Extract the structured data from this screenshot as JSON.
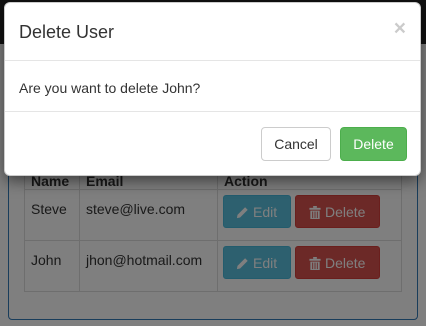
{
  "table": {
    "headers": {
      "name": "Name",
      "email": "Email",
      "action": "Action"
    },
    "rows": [
      {
        "name": "Steve",
        "email": "steve@live.com",
        "edit_label": "Edit",
        "delete_label": "Delete"
      },
      {
        "name": "John",
        "email": "jhon@hotmail.com",
        "edit_label": "Edit",
        "delete_label": "Delete"
      }
    ]
  },
  "modal": {
    "title": "Delete User",
    "close_label": "×",
    "message": "Are you want to delete John?",
    "cancel_label": "Cancel",
    "confirm_label": "Delete"
  },
  "icons": {
    "edit": "pencil-icon",
    "delete": "trash-icon",
    "close": "close-icon"
  },
  "colors": {
    "confirm": "#5cb85c",
    "edit": "#5bc0de",
    "delete": "#d9534f",
    "panel_border": "#337ab7",
    "navbar": "#222222"
  }
}
